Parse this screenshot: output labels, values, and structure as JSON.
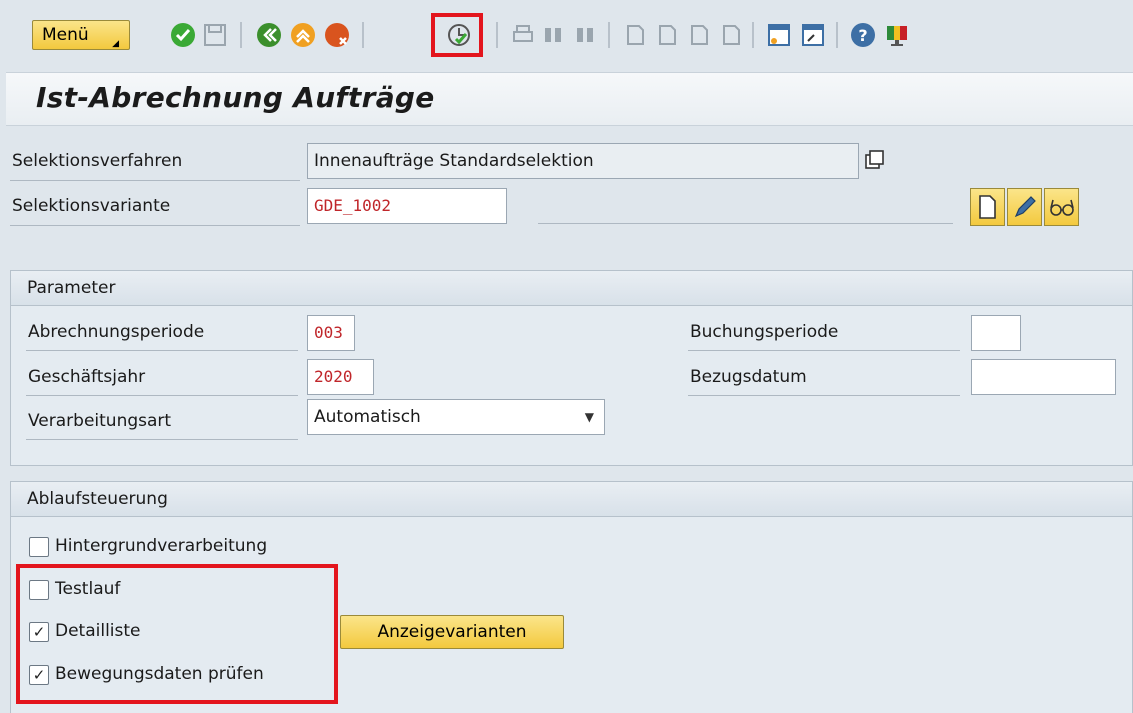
{
  "toolbar": {
    "menu_label": "Menü",
    "icons": [
      "check-icon",
      "save-icon",
      "back-icon",
      "exit-icon",
      "cancel-icon",
      "execute-icon",
      "print-icon",
      "find-icon",
      "find-next-icon",
      "first-page-icon",
      "previous-page-icon",
      "next-page-icon",
      "last-page-icon",
      "create-session-icon",
      "shortcut-icon",
      "help-icon",
      "customize-layout-icon"
    ]
  },
  "title": "Ist-Abrechnung Aufträge",
  "selection": {
    "method_label": "Selektionsverfahren",
    "method_value": "Innenaufträge Standardselektion",
    "variant_label": "Selektionsvariante",
    "variant_value": "GDE_1002"
  },
  "parameter": {
    "header": "Parameter",
    "period_label": "Abrechnungsperiode",
    "period_value": "003",
    "year_label": "Geschäftsjahr",
    "year_value": "2020",
    "processing_label": "Verarbeitungsart",
    "processing_value": "Automatisch",
    "posting_period_label": "Buchungsperiode",
    "posting_period_value": "",
    "reference_date_label": "Bezugsdatum",
    "reference_date_value": ""
  },
  "flow": {
    "header": "Ablaufsteuerung",
    "background_label": "Hintergrundverarbeitung",
    "background_checked": false,
    "test_label": "Testlauf",
    "test_checked": false,
    "detail_label": "Detailliste",
    "detail_checked": true,
    "movement_label": "Bewegungsdaten prüfen",
    "movement_checked": true,
    "display_variants_label": "Anzeigevarianten"
  },
  "colors": {
    "highlight": "#e3151d",
    "accent_button": "#f3c93e",
    "field_value": "#c0262a"
  }
}
